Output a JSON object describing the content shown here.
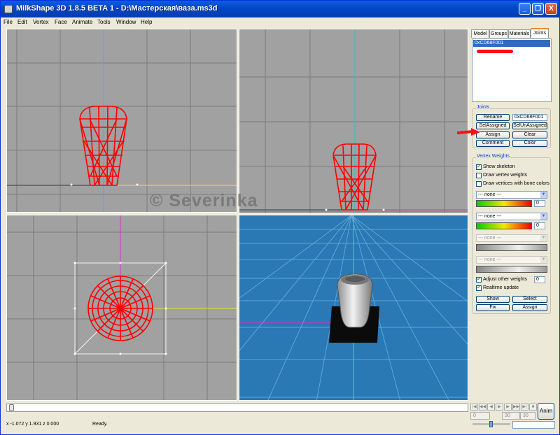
{
  "window": {
    "title": "MilkShape 3D 1.8.5 BETA 1 - D:\\Мастерская\\ваза.ms3d",
    "minimize_glyph": "_",
    "maximize_glyph": "❐",
    "close_glyph": "X"
  },
  "menu": [
    "File",
    "Edit",
    "Vertex",
    "Face",
    "Animate",
    "Tools",
    "Window",
    "Help"
  ],
  "watermark": "© Severinka",
  "panel": {
    "tabs": [
      "Model",
      "Groups",
      "Materials",
      "Joints"
    ],
    "active_tab": "Joints",
    "joints_list": [
      "0xCD68F001"
    ],
    "joints_group": {
      "title": "Joints",
      "rename_label": "Rename",
      "name_value": "0xCD68F001",
      "sel_assigned_label": "SelAssigned",
      "sel_unassigned_label": "SelUnAssigned",
      "assign_label": "Assign",
      "clear_label": "Clear",
      "comment_label": "Comment",
      "color_label": "Color"
    },
    "vertex_weights": {
      "title": "Vertex Weights",
      "show_skeleton": {
        "label": "Show skeleton",
        "checked": true
      },
      "draw_vertex_weights": {
        "label": "Draw vertex weights",
        "checked": false
      },
      "draw_bone_colors": {
        "label": "Draw vertices with bone colors",
        "checked": false
      },
      "bone_slots": [
        {
          "selected": "--- none ---",
          "weight": "0",
          "enabled": true
        },
        {
          "selected": "--- none ---",
          "weight": "0",
          "enabled": true
        },
        {
          "selected": "--- none ---",
          "weight": "",
          "enabled": false
        },
        {
          "selected": "--- none ---",
          "weight": "",
          "enabled": false
        }
      ],
      "adjust_other_weights": {
        "label": "Adjust other weights",
        "checked": true,
        "value": "0"
      },
      "realtime_update": {
        "label": "Realtime update",
        "checked": true
      },
      "show_label": "Show",
      "select_label": "Select",
      "fix_label": "Fix",
      "assign_label": "Assign"
    }
  },
  "timeline": {
    "start_frame": "0",
    "current_frame": "30",
    "end_frame": "30",
    "anim_label": "Anim"
  },
  "status": {
    "coords": "x -1.072 y 1.931 z 0.000",
    "message": "Ready."
  },
  "colors": {
    "viewport_bg": "#a1a1a1",
    "perspective_bg": "#2a78b4",
    "mesh": "#ff0000",
    "accent_tab": "#e68b2c"
  }
}
